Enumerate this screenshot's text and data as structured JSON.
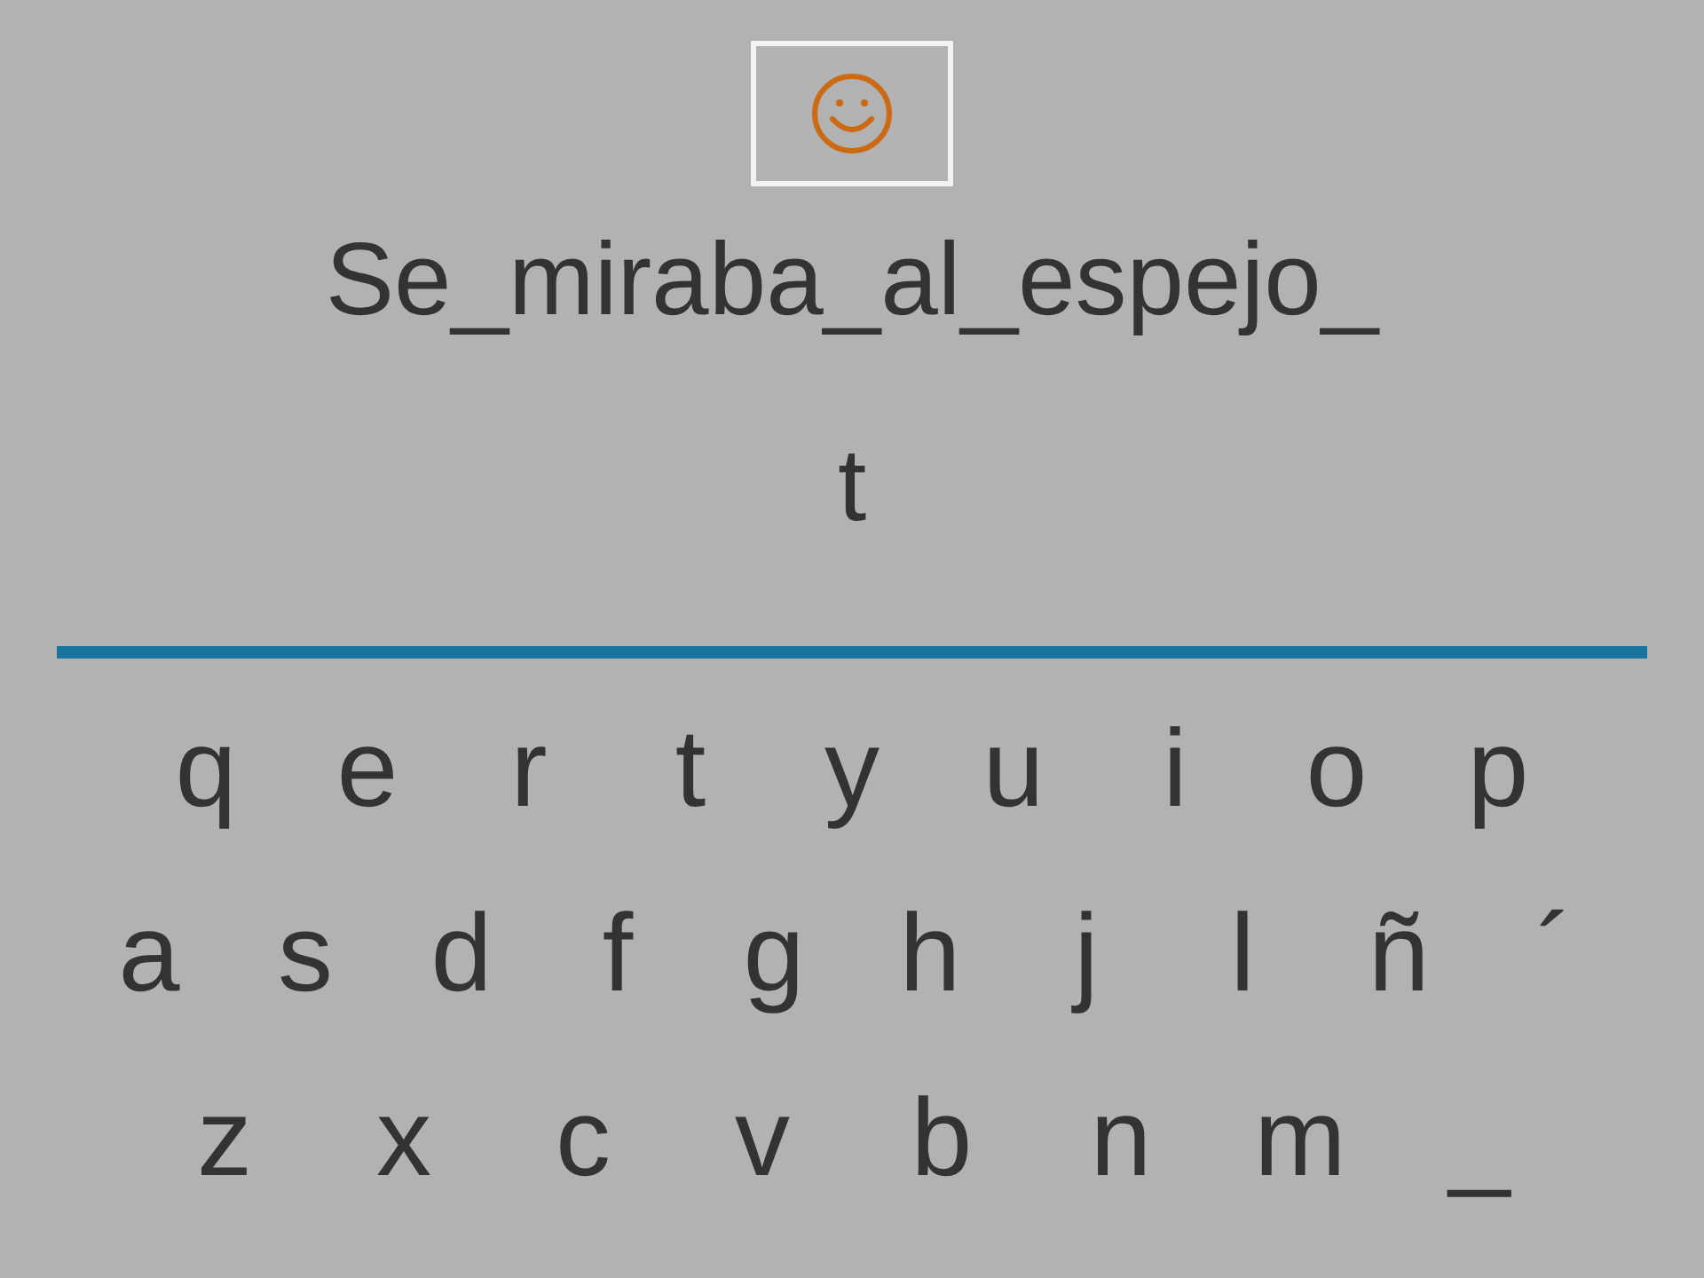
{
  "sentence": "Se_miraba_al_espejo_",
  "answer": "t",
  "keyboard": {
    "rows": [
      [
        "q",
        "e",
        "r",
        "t",
        "y",
        "u",
        "i",
        "o",
        "p"
      ],
      [
        "a",
        "s",
        "d",
        "f",
        "g",
        "h",
        "j",
        "l",
        "ñ",
        "´"
      ],
      [
        "z",
        "x",
        "c",
        "v",
        "b",
        "n",
        "m",
        "_"
      ]
    ]
  }
}
